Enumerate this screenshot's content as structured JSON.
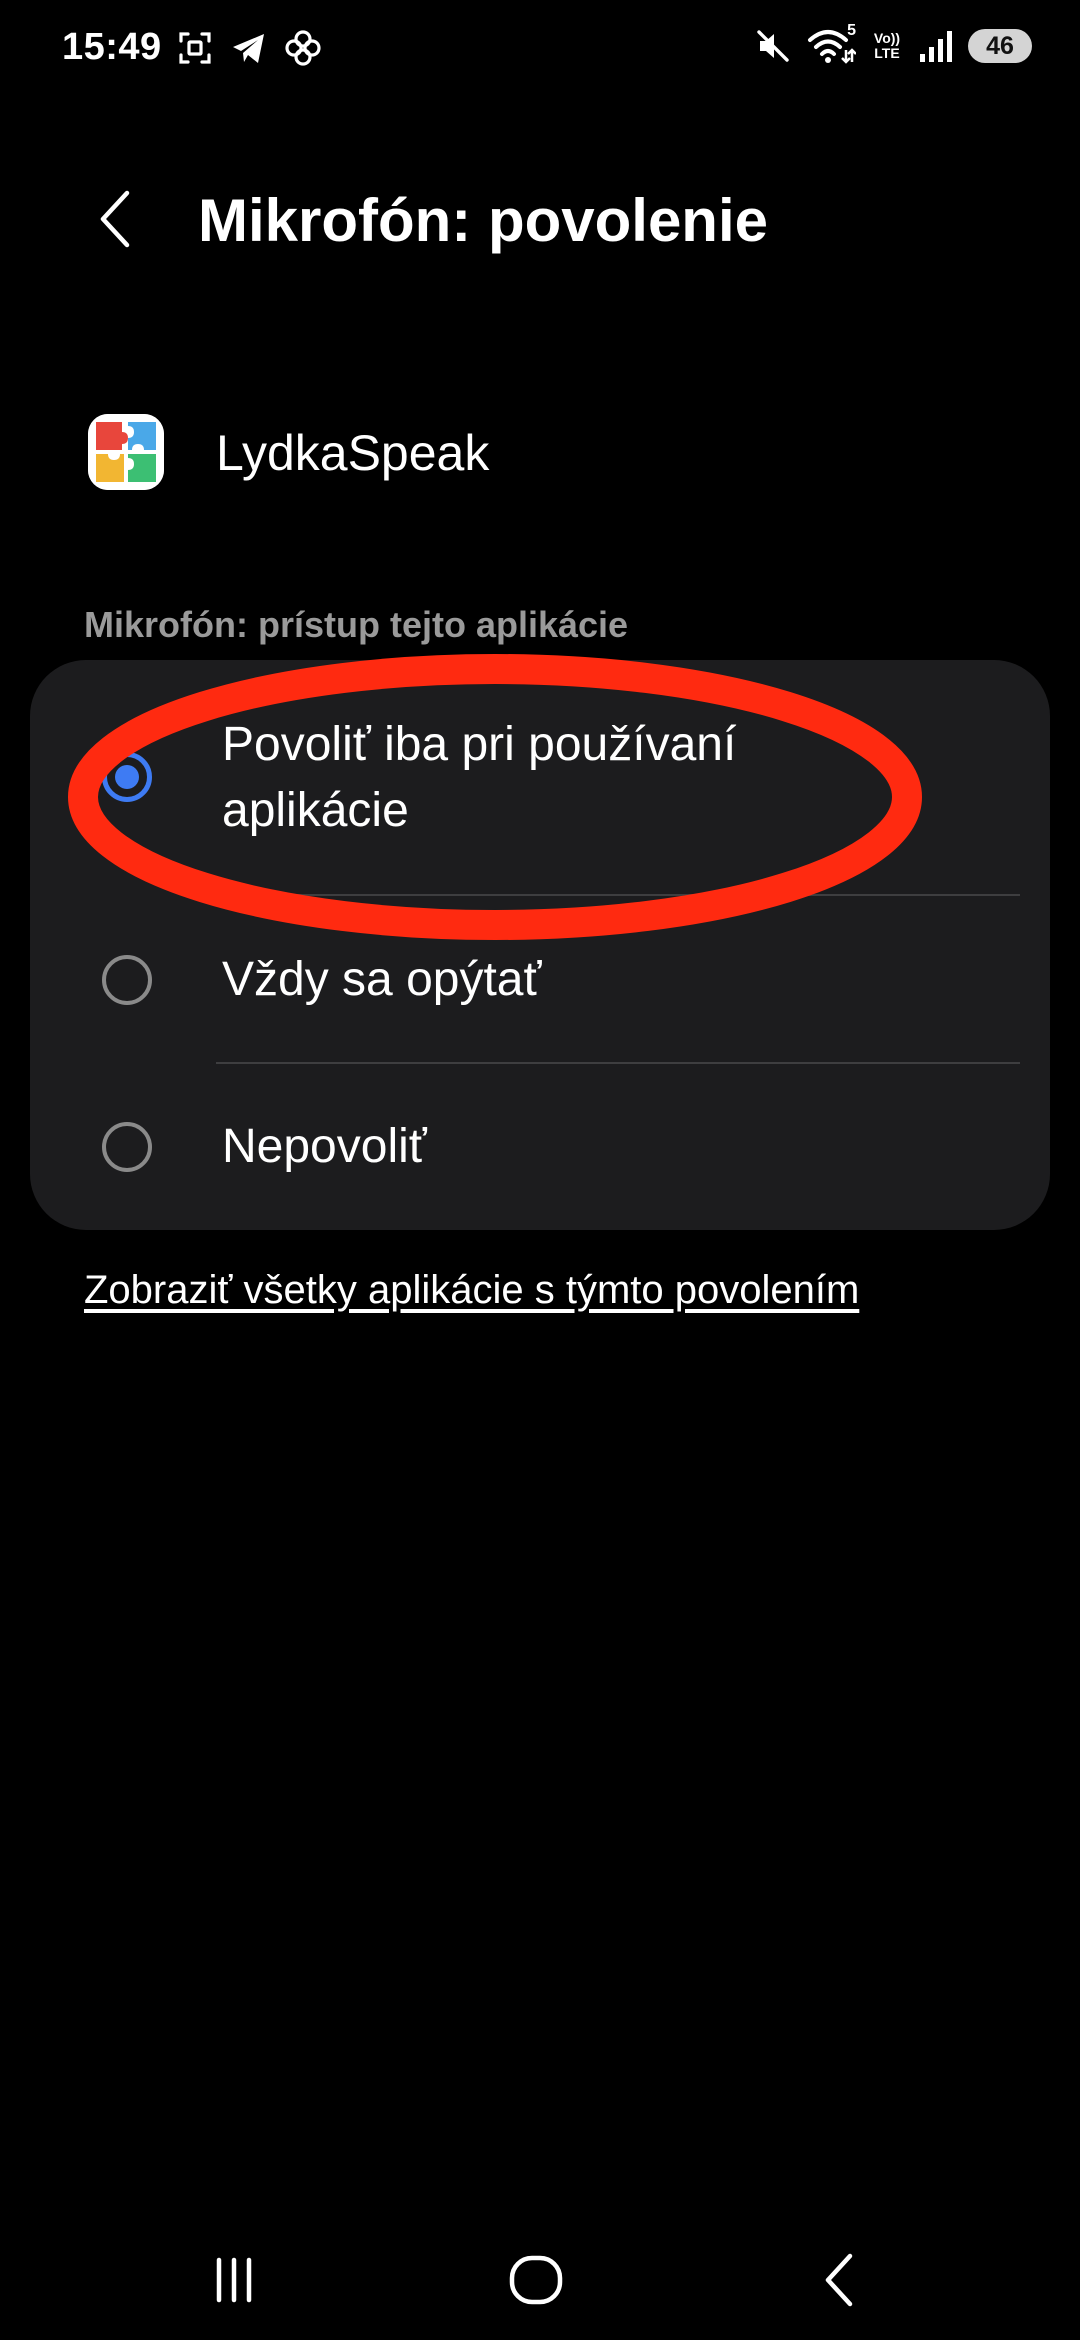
{
  "status_bar": {
    "time": "15:49",
    "left_icons": [
      "screenshot-icon",
      "telegram-icon",
      "pinwheel-icon"
    ],
    "right_icons": [
      "mute-icon",
      "wifi-icon",
      "volte-lte-icon",
      "signal-icon"
    ],
    "wifi_badge": "5",
    "volte_top": "Vo))",
    "volte_bottom": "LTE",
    "battery": "46"
  },
  "header": {
    "back_icon": "chevron-left-icon",
    "title": "Mikrofón: povolenie"
  },
  "app": {
    "icon": "puzzle-app-icon",
    "name": "LydkaSpeak"
  },
  "section": {
    "label": "Mikrofón: prístup tejto aplikácie"
  },
  "options": [
    {
      "label": "Povoliť iba pri používaní aplikácie",
      "selected": true
    },
    {
      "label": "Vždy sa opýtať",
      "selected": false
    },
    {
      "label": "Nepovoliť",
      "selected": false
    }
  ],
  "link": {
    "label": "Zobraziť všetky aplikácie s týmto povolením"
  },
  "nav_bar": {
    "icons": [
      "recents-icon",
      "home-icon",
      "back-icon"
    ]
  },
  "colors": {
    "background": "#000000",
    "card": "#1c1c1e",
    "accent": "#3e7bf3",
    "annotation": "#ff2a10",
    "muted_text": "#9a9a9a"
  }
}
